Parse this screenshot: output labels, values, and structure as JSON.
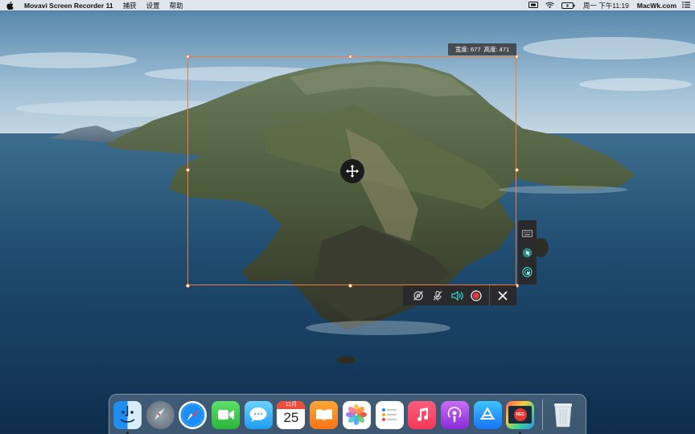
{
  "menubar": {
    "app_name": "Movavi Screen Recorder 11",
    "menus": [
      "捕获",
      "设置",
      "帮助"
    ],
    "clock": "周一 下午11:19",
    "site": "MacWk.com"
  },
  "capture": {
    "width_label": "宽度: 677",
    "height_label": "高度: 471"
  },
  "side_toolbar": {
    "items": [
      "keyboard-icon",
      "cursor-highlight-icon",
      "click-effect-icon"
    ]
  },
  "record_toolbar": {
    "items": [
      "webcam-off-icon",
      "microphone-off-icon",
      "system-audio-icon",
      "record-icon",
      "close-icon"
    ]
  },
  "calendar": {
    "month": "11月",
    "day": "25"
  },
  "dock": {
    "items": [
      "finder-icon",
      "launchpad-icon",
      "safari-icon",
      "facetime-icon",
      "messages-icon",
      "calendar-icon",
      "books-icon",
      "photos-icon",
      "reminders-icon",
      "music-icon",
      "podcasts-icon",
      "app-store-icon",
      "screen-recorder-icon",
      "trash-icon"
    ]
  },
  "rec_badge": "REC",
  "colors": {
    "capture_border": "#f07b3f",
    "toolbar_bg": "#2a2a2d",
    "accent_teal": "#2fd4c6",
    "record_red": "#e53935"
  }
}
